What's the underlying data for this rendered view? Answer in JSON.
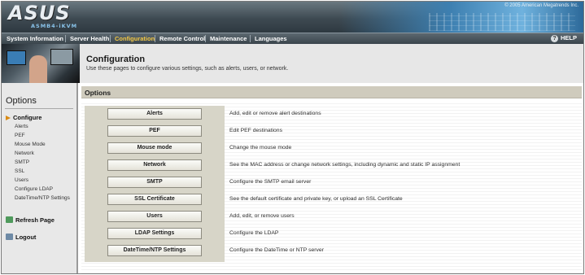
{
  "header": {
    "logo": "ASUS",
    "sublogo": "ASMB4-iKVM",
    "copyright": "© 2005 American Megatrends Inc."
  },
  "nav": {
    "items": [
      "System Information",
      "Server Health",
      "Configuration",
      "Remote Control",
      "Maintenance",
      "Languages"
    ],
    "active": "Configuration",
    "help_label": "HELP"
  },
  "page": {
    "title": "Configuration",
    "subtitle": "Use these pages to configure various settings, such as alerts, users, or network."
  },
  "sidebar": {
    "heading": "Options",
    "category": "Configure",
    "items": [
      "Alerts",
      "PEF",
      "Mouse Mode",
      "Network",
      "SMTP",
      "SSL",
      "Users",
      "Configure LDAP",
      "DateTime/NTP Settings"
    ],
    "refresh_label": "Refresh Page",
    "logout_label": "Logout"
  },
  "main": {
    "section_title": "Options",
    "options": [
      {
        "button": "Alerts",
        "description": "Add, edit or remove alert destinations"
      },
      {
        "button": "PEF",
        "description": "Edit PEF destinations"
      },
      {
        "button": "Mouse mode",
        "description": "Change the mouse mode"
      },
      {
        "button": "Network",
        "description": "See the MAC address or change network settings, including dynamic and static IP assignment"
      },
      {
        "button": "SMTP",
        "description": "Configure the SMTP email server"
      },
      {
        "button": "SSL Certificate",
        "description": "See the default certificate and private key, or upload an SSL Certificate"
      },
      {
        "button": "Users",
        "description": "Add, edit, or remove users"
      },
      {
        "button": "LDAP Settings",
        "description": "Configure the LDAP"
      },
      {
        "button": "DateTime/NTP Settings",
        "description": "Configure the DateTime or NTP server"
      }
    ]
  },
  "colors": {
    "nav_active": "#f3c846",
    "sidebar_arrow": "#d98a12",
    "options_bar": "#cfcbbd"
  },
  "icons": {
    "refresh": "refresh-icon",
    "logout": "logout-icon",
    "help": "help-icon"
  }
}
